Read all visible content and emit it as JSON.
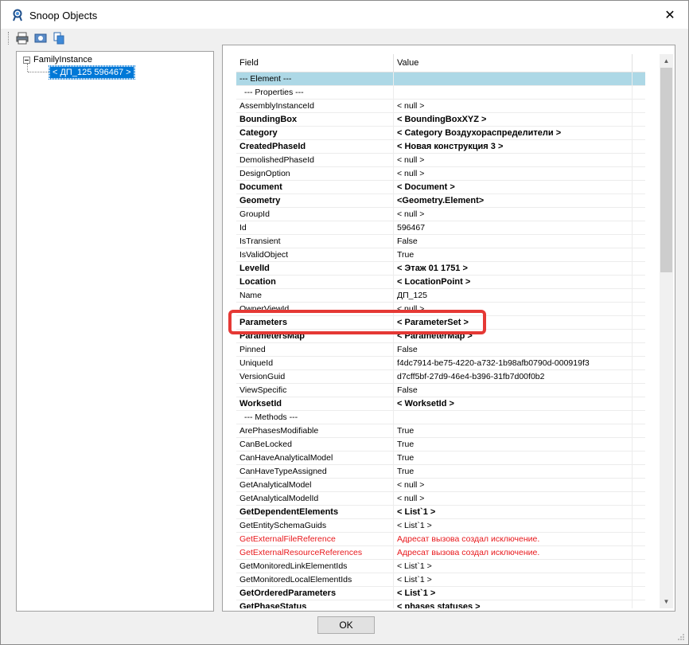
{
  "window": {
    "title": "Snoop Objects",
    "close_glyph": "✕"
  },
  "toolbar": {
    "icons": [
      "print-icon",
      "preview-icon",
      "copy-icon"
    ]
  },
  "tree": {
    "root_label": "FamilyInstance",
    "selected_child": "< ДП_125  596467 >"
  },
  "grid": {
    "headers": {
      "field": "Field",
      "value": "Value"
    },
    "rows": [
      {
        "field": "--- Element ---",
        "value": "",
        "type": "section-hl"
      },
      {
        "field": "--- Properties ---",
        "value": "",
        "type": "sub"
      },
      {
        "field": "AssemblyInstanceId",
        "value": "< null >",
        "type": "normal"
      },
      {
        "field": "BoundingBox",
        "value": "< BoundingBoxXYZ >",
        "type": "bold"
      },
      {
        "field": "Category",
        "value": "< Category  Воздухораспределители >",
        "type": "bold"
      },
      {
        "field": "CreatedPhaseId",
        "value": "< Новая конструкция  3 >",
        "type": "bold"
      },
      {
        "field": "DemolishedPhaseId",
        "value": "< null >",
        "type": "normal"
      },
      {
        "field": "DesignOption",
        "value": "< null >",
        "type": "normal"
      },
      {
        "field": "Document",
        "value": "< Document >",
        "type": "bold"
      },
      {
        "field": "Geometry",
        "value": "<Geometry.Element>",
        "type": "bold"
      },
      {
        "field": "GroupId",
        "value": "< null >",
        "type": "normal"
      },
      {
        "field": "Id",
        "value": "596467",
        "type": "normal"
      },
      {
        "field": "IsTransient",
        "value": "False",
        "type": "normal"
      },
      {
        "field": "IsValidObject",
        "value": "True",
        "type": "normal"
      },
      {
        "field": "LevelId",
        "value": "< Этаж 01  1751 >",
        "type": "bold"
      },
      {
        "field": "Location",
        "value": "< LocationPoint >",
        "type": "bold"
      },
      {
        "field": "Name",
        "value": "ДП_125",
        "type": "normal"
      },
      {
        "field": "OwnerViewId",
        "value": "< null >",
        "type": "normal"
      },
      {
        "field": "Parameters",
        "value": "< ParameterSet >",
        "type": "bold"
      },
      {
        "field": "ParametersMap",
        "value": "< ParameterMap >",
        "type": "bold"
      },
      {
        "field": "Pinned",
        "value": "False",
        "type": "normal"
      },
      {
        "field": "UniqueId",
        "value": "f4dc7914-be75-4220-a732-1b98afb0790d-000919f3",
        "type": "normal"
      },
      {
        "field": "VersionGuid",
        "value": "d7cff5bf-27d9-46e4-b396-31fb7d00f0b2",
        "type": "normal"
      },
      {
        "field": "ViewSpecific",
        "value": "False",
        "type": "normal"
      },
      {
        "field": "WorksetId",
        "value": "< WorksetId >",
        "type": "bold"
      },
      {
        "field": "--- Methods ---",
        "value": "",
        "type": "sub"
      },
      {
        "field": "ArePhasesModifiable",
        "value": "True",
        "type": "normal"
      },
      {
        "field": "CanBeLocked",
        "value": "True",
        "type": "normal"
      },
      {
        "field": "CanHaveAnalyticalModel",
        "value": "True",
        "type": "normal"
      },
      {
        "field": "CanHaveTypeAssigned",
        "value": "True",
        "type": "normal"
      },
      {
        "field": "GetAnalyticalModel",
        "value": "< null >",
        "type": "normal"
      },
      {
        "field": "GetAnalyticalModelId",
        "value": "< null >",
        "type": "normal"
      },
      {
        "field": "GetDependentElements",
        "value": "< List`1 >",
        "type": "bold"
      },
      {
        "field": "GetEntitySchemaGuids",
        "value": "< List`1 >",
        "type": "normal"
      },
      {
        "field": "GetExternalFileReference",
        "value": "Адресат вызова создал исключение.",
        "type": "err"
      },
      {
        "field": "GetExternalResourceReferences",
        "value": "Адресат вызова создал исключение.",
        "type": "err"
      },
      {
        "field": "GetMonitoredLinkElementIds",
        "value": "< List`1 >",
        "type": "normal"
      },
      {
        "field": "GetMonitoredLocalElementIds",
        "value": "< List`1 >",
        "type": "normal"
      },
      {
        "field": "GetOrderedParameters",
        "value": "< List`1 >",
        "type": "bold"
      },
      {
        "field": "GetPhaseStatus",
        "value": "< phases statuses >",
        "type": "bold"
      }
    ]
  },
  "footer": {
    "ok_label": "OK"
  },
  "colors": {
    "selection": "#0078d7",
    "section_highlight": "#add8e6",
    "error_text": "#e8191d",
    "callout": "#e53935"
  }
}
